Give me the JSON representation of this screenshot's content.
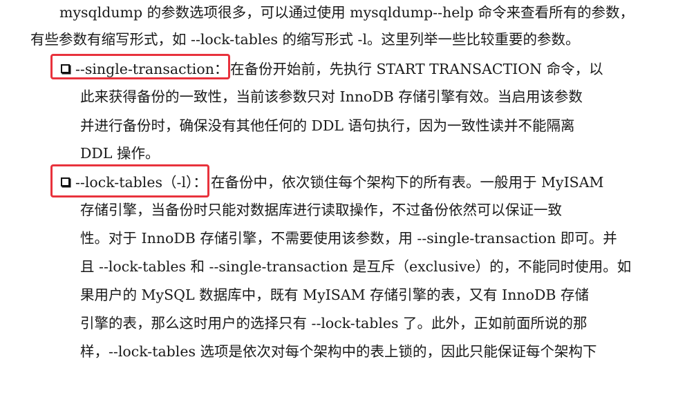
{
  "intro": {
    "line1": "mysqldump 的参数选项很多，可以通过使用 mysqldump--help 命令来查看所有的参数，",
    "line2": "有些参数有缩写形式，如 --lock-tables 的缩写形式 -l。这里列举一些比较重要的参数。"
  },
  "options": [
    {
      "term": "--single-transaction：",
      "lines": [
        "在备份开始前，先执行 START TRANSACTION 命令，以",
        "此来获得备份的一致性，当前该参数只对 InnoDB 存储引擎有效。当启用该参数",
        "并进行备份时，确保没有其他任何的 DDL 语句执行，因为一致性读并不能隔离",
        "DDL 操作。"
      ]
    },
    {
      "term": "--lock-tables（-l）：",
      "lines": [
        "在备份中，依次锁住每个架构下的所有表。一般用于 MyISAM",
        "存储引擎，当备份时只能对数据库进行读取操作，不过备份依然可以保证一致",
        "性。对于 InnoDB 存储引擎，不需要使用该参数，用 --single-transaction 即可。并",
        "且 --lock-tables 和 --single-transaction 是互斥（exclusive）的，不能同时使用。如",
        "果用户的 MySQL 数据库中，既有 MyISAM 存储引擎的表，又有 InnoDB 存储",
        "引擎的表，那么这时用户的选择只有 --lock-tables 了。此外，正如前面所说的那",
        "样，--lock-tables 选项是依次对每个架构中的表上锁的，因此只能保证每个架构下"
      ]
    }
  ]
}
